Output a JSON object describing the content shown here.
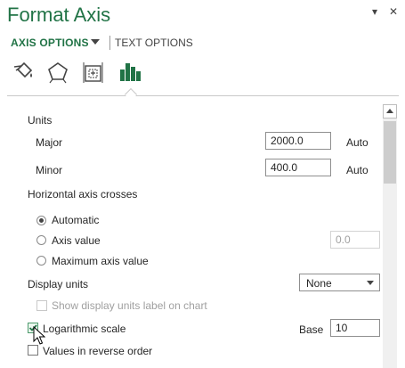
{
  "pane": {
    "title": "Format Axis",
    "options_caret": "▾",
    "close_glyph": "✕"
  },
  "tabs": {
    "axis_options": "AXIS OPTIONS",
    "text_options": "TEXT OPTIONS"
  },
  "icons": [
    "fill-line-icon",
    "effects-icon",
    "size-properties-icon",
    "axis-options-icon"
  ],
  "units": {
    "header": "Units",
    "major_label": "Major",
    "major_value": "2000.0",
    "major_mode": "Auto",
    "minor_label": "Minor",
    "minor_value": "400.0",
    "minor_mode": "Auto"
  },
  "crosses": {
    "header": "Horizontal axis crosses",
    "automatic": "Automatic",
    "axis_value": "Axis value",
    "axis_value_input": "0.0",
    "maximum": "Maximum axis value",
    "selected": "automatic"
  },
  "display_units": {
    "label": "Display units",
    "value": "None",
    "show_label": "Show display units label on chart"
  },
  "log": {
    "label": "Logarithmic scale",
    "checked": true,
    "base_label": "Base",
    "base_value": "10"
  },
  "reverse": {
    "label": "Values in reverse order",
    "checked": false
  },
  "colors": {
    "accent": "#217346"
  }
}
